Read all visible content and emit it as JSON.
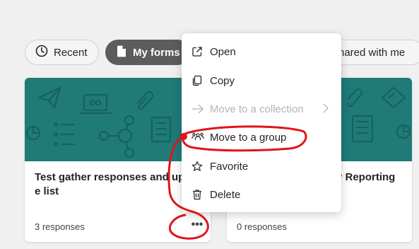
{
  "filters": {
    "recent": "Recent",
    "my_forms": "My forms",
    "shared_with_me": "hared with me"
  },
  "cards": [
    {
      "title": "Test gather responses and up\ne list",
      "responses": "3 responses",
      "more": "•••"
    },
    {
      "title": "y Reporting",
      "responses": "0 responses"
    }
  ],
  "context_menu": {
    "items": [
      {
        "label": "Open",
        "icon": "open-external-icon",
        "disabled": false
      },
      {
        "label": "Copy",
        "icon": "copy-icon",
        "disabled": false
      },
      {
        "label": "Move to a collection",
        "icon": "arrow-right-icon",
        "disabled": true
      },
      {
        "label": "Move to a group",
        "icon": "people-group-icon",
        "disabled": false
      },
      {
        "label": "Favorite",
        "icon": "star-icon",
        "disabled": false
      },
      {
        "label": "Delete",
        "icon": "trash-icon",
        "disabled": false
      }
    ]
  },
  "colors": {
    "banner": "#1f7a78",
    "active_pill": "#5c5c5c",
    "annotation": "#e0141b"
  }
}
